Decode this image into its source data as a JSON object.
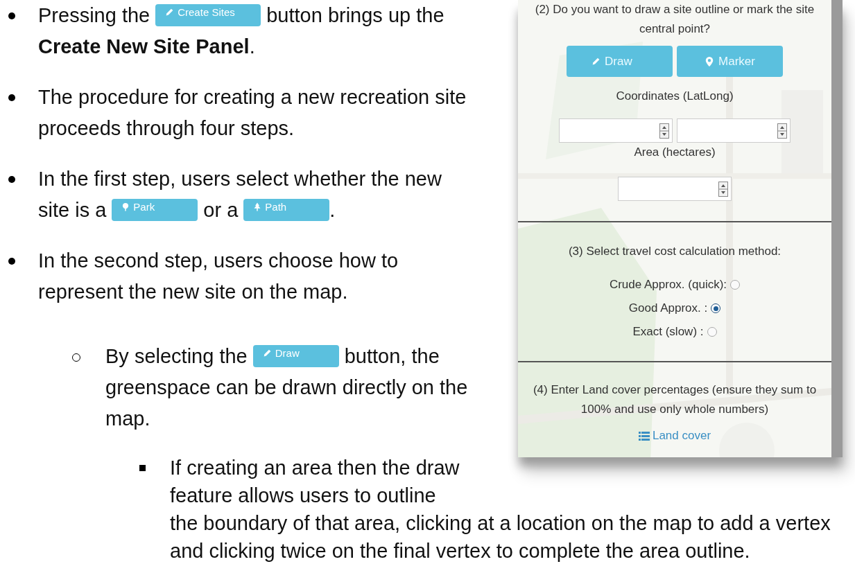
{
  "document": {
    "items": [
      {
        "kind": "bullet",
        "lines": [
          [
            {
              "kind": "text",
              "text": "Pressing the"
            },
            {
              "kind": "button",
              "label": "Create Sites"
            },
            {
              "kind": "text",
              "text": "button brings up the"
            }
          ],
          [
            {
              "kind": "text",
              "text": "**Create New Site Panel**."
            }
          ]
        ]
      },
      {
        "kind": "bullet",
        "lines": [
          [
            {
              "kind": "text",
              "text": "The procedure for creating a new recreation site"
            }
          ],
          [
            {
              "kind": "text",
              "text": "proceeds through four steps."
            }
          ]
        ]
      },
      {
        "kind": "bullet",
        "lines": [
          [
            {
              "kind": "text",
              "text": "In the first step, users select whether the new"
            }
          ],
          [
            {
              "kind": "text",
              "text": "site is a"
            },
            {
              "kind": "button",
              "label": "Park"
            },
            {
              "kind": "text",
              "text": "or a"
            },
            {
              "kind": "button",
              "label": "Path"
            },
            {
              "kind": "tail",
              "text": "."
            }
          ]
        ]
      },
      {
        "kind": "bullet",
        "lines": [
          [
            {
              "kind": "text",
              "text": "In the second step, users choose how to"
            }
          ],
          [
            {
              "kind": "text",
              "text": "represent the new site on the map."
            }
          ]
        ],
        "children": [
          {
            "kind": "circle",
            "lines": [
              [
                {
                  "kind": "text",
                  "text": "By selecting the"
                },
                {
                  "kind": "button",
                  "label": "Draw"
                },
                {
                  "kind": "text",
                  "text": "button, the"
                }
              ],
              [
                {
                  "kind": "text",
                  "text": "greenspace can be drawn directly on the"
                }
              ],
              [
                {
                  "kind": "text",
                  "text": "map."
                }
              ]
            ],
            "children": [
              {
                "kind": "square",
                "lines": [
                  [
                    {
                      "kind": "text",
                      "text": "If creating an area then the draw"
                    }
                  ],
                  [
                    {
                      "kind": "text",
                      "text": "feature allows users to outline"
                    }
                  ],
                  [
                    {
                      "kind": "text",
                      "text": "the boundary of that area, clicking at a location on the map to add a vertex"
                    }
                  ],
                  [
                    {
                      "kind": "text",
                      "text": "and clicking twice on the final vertex to complete the area outline."
                    }
                  ]
                ]
              }
            ]
          }
        ]
      }
    ]
  },
  "panel": {
    "question": "(2) Do you want to draw a site outline or mark the site central point?",
    "buttons": [
      {
        "label": "Draw"
      },
      {
        "label": "Marker"
      }
    ],
    "coordinates_label": "Coordinates (LatLong)",
    "area_label": "Area (hectares)",
    "step3": "(3) Select travel cost calculation method:",
    "methods": [
      {
        "label": "Crude Approx. (quick):",
        "selected": false
      },
      {
        "label": "Good Approx. :",
        "selected": true
      },
      {
        "label": "Exact (slow) :",
        "selected": false
      }
    ],
    "step4": "(4) Enter Land cover percentages (ensure they sum to 100% and use only whole numbers)",
    "land_cover_link": "Land cover"
  }
}
